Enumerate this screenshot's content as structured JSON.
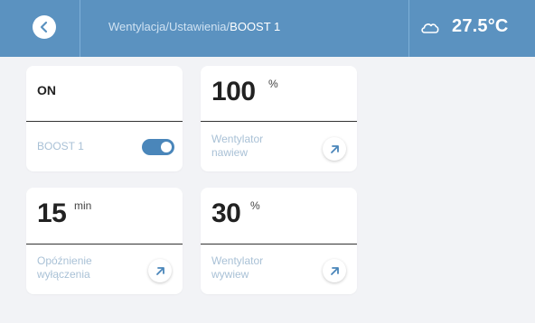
{
  "header": {
    "breadcrumb_path": "Wentylacja/Ustawienia/",
    "breadcrumb_current": "BOOST 1",
    "temperature": "27.5°C",
    "weather_icon": "cloud-icon",
    "back_icon": "chevron-left-icon",
    "bar_color": "#5b92c0"
  },
  "cards": {
    "boost": {
      "status": "ON",
      "label": "BOOST 1",
      "toggle_on": true
    },
    "supply_fan": {
      "value": "100",
      "unit": "%",
      "label_line1": "Wentylator",
      "label_line2": "nawiew"
    },
    "off_delay": {
      "value": "15",
      "unit": "min",
      "label_line1": "Opóźnienie",
      "label_line2": "wyłączenia"
    },
    "exhaust_fan": {
      "value": "30",
      "unit": "%",
      "label_line1": "Wentylator",
      "label_line2": "wywiew"
    }
  },
  "colors": {
    "accent": "#4a86ba",
    "label": "#a9c1d6",
    "background": "#f2f3f6"
  }
}
